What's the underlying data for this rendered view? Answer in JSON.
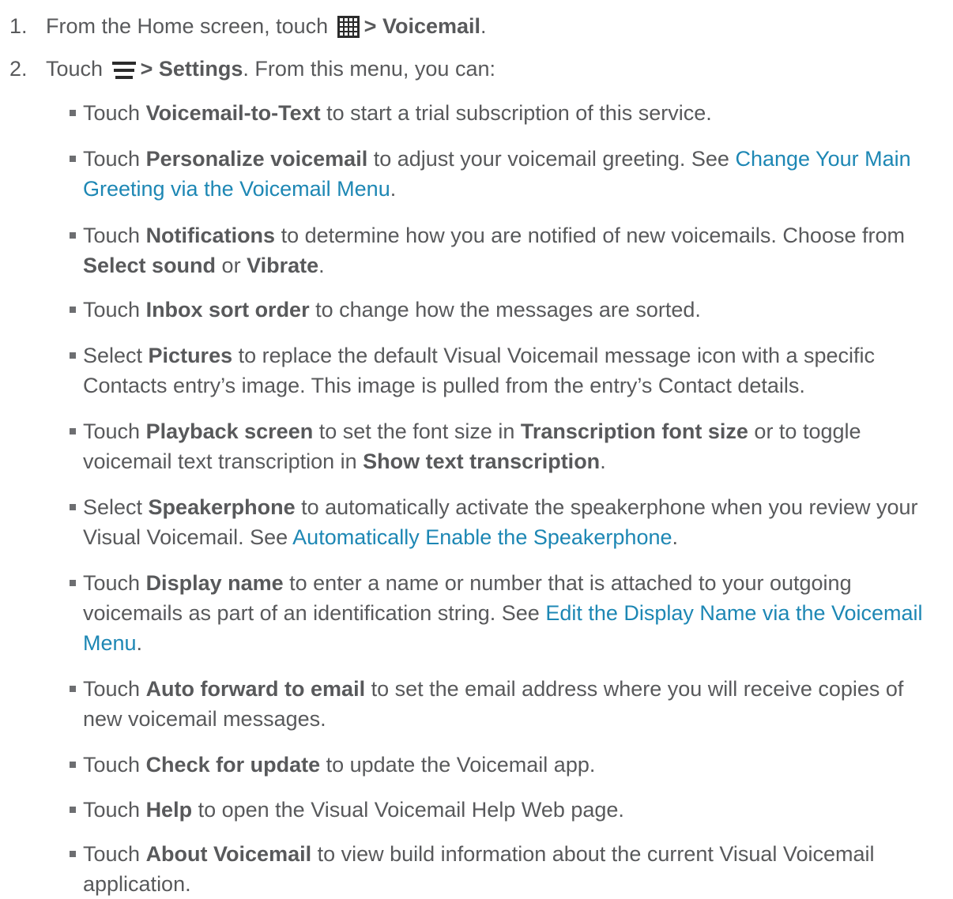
{
  "steps": [
    {
      "num": "1.",
      "pre": "From the Home screen, touch",
      "icon": "apps-grid-icon",
      "bold": "> Voicemail",
      "post": "."
    },
    {
      "num": "2.",
      "pre": "Touch",
      "icon": "menu-icon",
      "bold": "> Settings",
      "post": ". From this menu, you can:"
    }
  ],
  "bullets": [
    {
      "segments": [
        {
          "t": "n",
          "v": "Touch "
        },
        {
          "t": "b",
          "v": "Voicemail-to-Text"
        },
        {
          "t": "n",
          "v": " to start a trial subscription of this service."
        }
      ]
    },
    {
      "segments": [
        {
          "t": "n",
          "v": "Touch "
        },
        {
          "t": "b",
          "v": "Personalize voicemail"
        },
        {
          "t": "n",
          "v": " to adjust your voicemail greeting. See "
        },
        {
          "t": "l",
          "v": "Change Your Main Greeting via the Voicemail Menu"
        },
        {
          "t": "n",
          "v": "."
        }
      ]
    },
    {
      "segments": [
        {
          "t": "n",
          "v": "Touch "
        },
        {
          "t": "b",
          "v": "Notifications"
        },
        {
          "t": "n",
          "v": " to determine how you are notified of new voicemails. Choose from "
        },
        {
          "t": "b",
          "v": "Select sound"
        },
        {
          "t": "n",
          "v": " or "
        },
        {
          "t": "b",
          "v": "Vibrate"
        },
        {
          "t": "n",
          "v": "."
        }
      ]
    },
    {
      "segments": [
        {
          "t": "n",
          "v": "Touch "
        },
        {
          "t": "b",
          "v": "Inbox sort order"
        },
        {
          "t": "n",
          "v": " to change how the messages are sorted."
        }
      ]
    },
    {
      "segments": [
        {
          "t": "n",
          "v": "Select "
        },
        {
          "t": "b",
          "v": "Pictures"
        },
        {
          "t": "n",
          "v": " to replace the default Visual Voicemail message icon with a specific Contacts entry’s image. This image is pulled from the entry’s Contact details."
        }
      ]
    },
    {
      "segments": [
        {
          "t": "n",
          "v": "Touch "
        },
        {
          "t": "b",
          "v": "Playback screen"
        },
        {
          "t": "n",
          "v": " to set the font size in "
        },
        {
          "t": "b",
          "v": "Transcription font size"
        },
        {
          "t": "n",
          "v": " or to toggle voicemail text transcription in "
        },
        {
          "t": "b",
          "v": "Show text transcription"
        },
        {
          "t": "n",
          "v": "."
        }
      ]
    },
    {
      "segments": [
        {
          "t": "n",
          "v": "Select "
        },
        {
          "t": "b",
          "v": "Speakerphone"
        },
        {
          "t": "n",
          "v": " to automatically activate the speakerphone when you review your Visual Voicemail. See "
        },
        {
          "t": "l",
          "v": "Automatically Enable the Speakerphone"
        },
        {
          "t": "n",
          "v": "."
        }
      ]
    },
    {
      "segments": [
        {
          "t": "n",
          "v": "Touch "
        },
        {
          "t": "b",
          "v": "Display name"
        },
        {
          "t": "n",
          "v": " to enter a name or number that is attached to your outgoing voicemails as part of an identification string. See "
        },
        {
          "t": "l",
          "v": "Edit the Display Name via the Voicemail Menu"
        },
        {
          "t": "n",
          "v": "."
        }
      ]
    },
    {
      "segments": [
        {
          "t": "n",
          "v": "Touch "
        },
        {
          "t": "b",
          "v": "Auto forward to email"
        },
        {
          "t": "n",
          "v": " to set the email address where you will receive copies of new voicemail messages."
        }
      ]
    },
    {
      "segments": [
        {
          "t": "n",
          "v": "Touch "
        },
        {
          "t": "b",
          "v": "Check for update"
        },
        {
          "t": "n",
          "v": " to update the Voicemail app."
        }
      ]
    },
    {
      "segments": [
        {
          "t": "n",
          "v": "Touch "
        },
        {
          "t": "b",
          "v": "Help"
        },
        {
          "t": "n",
          "v": " to open the Visual Voicemail Help Web page."
        }
      ]
    },
    {
      "segments": [
        {
          "t": "n",
          "v": "Touch "
        },
        {
          "t": "b",
          "v": "About Voicemail"
        },
        {
          "t": "n",
          "v": " to view build information about the current Visual Voicemail application."
        }
      ]
    }
  ]
}
